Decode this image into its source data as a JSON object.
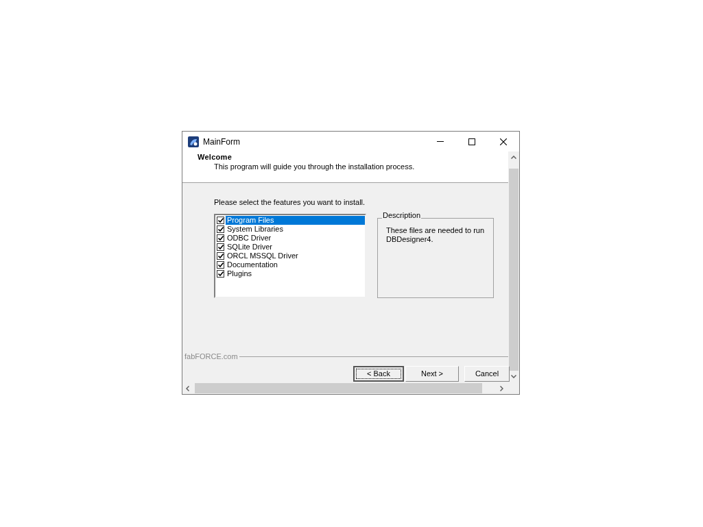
{
  "window": {
    "title": "MainForm"
  },
  "header": {
    "title": "Welcome",
    "subtitle": "This program will guide you through the installation process."
  },
  "features": {
    "prompt": "Please select the features you want to install.",
    "items": [
      {
        "label": "Program Files",
        "checked": true,
        "selected": true
      },
      {
        "label": "System Libraries",
        "checked": true,
        "selected": false
      },
      {
        "label": "ODBC Driver",
        "checked": true,
        "selected": false
      },
      {
        "label": "SQLite Driver",
        "checked": true,
        "selected": false
      },
      {
        "label": "ORCL MSSQL Driver",
        "checked": true,
        "selected": false
      },
      {
        "label": "Documentation",
        "checked": true,
        "selected": false
      },
      {
        "label": "Plugins",
        "checked": true,
        "selected": false
      }
    ]
  },
  "description": {
    "title": "Description",
    "text": "These files are needed to run DBDesigner4."
  },
  "footer": {
    "brand": "fabFORCE.com"
  },
  "buttons": [
    {
      "label": "< Back",
      "focused": true
    },
    {
      "label": "Next >",
      "focused": false
    },
    {
      "label": "Cancel",
      "focused": false
    }
  ]
}
